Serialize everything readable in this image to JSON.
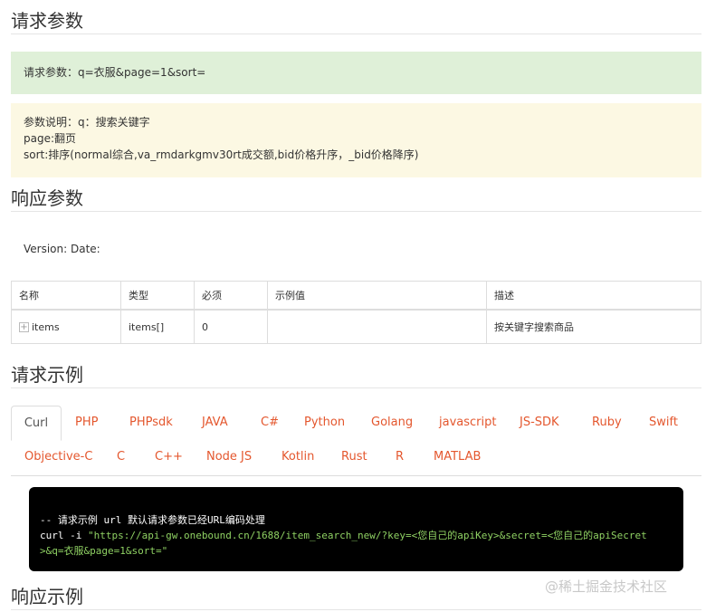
{
  "sections": {
    "request_params_title": "请求参数",
    "response_params_title": "响应参数",
    "request_example_title": "请求示例",
    "response_example_title": "响应示例"
  },
  "request_alert": "请求参数：q=衣服&page=1&sort=",
  "param_notes": [
    "参数说明：q：搜索关键字",
    "page:翻页",
    "sort:排序(normal综合,va_rmdarkgmv30rt成交额,bid价格升序，_bid价格降序)"
  ],
  "version_line": "Version: Date:",
  "table": {
    "headers": [
      "名称",
      "类型",
      "必须",
      "示例值",
      "描述"
    ],
    "rows": [
      {
        "name": "items",
        "type": "items[]",
        "required": "0",
        "example": "",
        "desc": "按关键字搜索商品"
      }
    ],
    "expander_glyph": "+"
  },
  "tabs_row1": [
    "Curl",
    "PHP",
    "PHPsdk",
    "JAVA",
    "C#",
    "Python",
    "Golang",
    "javascript",
    "JS-SDK",
    "Ruby",
    "Swift"
  ],
  "tabs_row2": [
    "Objective-C",
    "C",
    "C++",
    "Node JS",
    "Kotlin",
    "Rust",
    "R",
    "MATLAB"
  ],
  "code": {
    "comment_prefix": "-- 请求示例 ",
    "comment_keyword": "url",
    "comment_suffix": " 默认请求参数已经URL编码处理",
    "cmd": "curl -i ",
    "url_line1": "\"https://api-gw.onebound.cn/1688/item_search_new/?key=<您自己的apiKey>&secret=<您自己的apiSecret",
    "url_line2": ">&q=衣服&page=1&sort=\""
  },
  "watermark": "@稀土掘金技术社区",
  "colors": {
    "tab_link": "#e4572e",
    "code_bg": "#000000",
    "code_string": "#8fd163",
    "alert_green": "#dff0d8",
    "alert_yellow": "#fcf8e3"
  }
}
